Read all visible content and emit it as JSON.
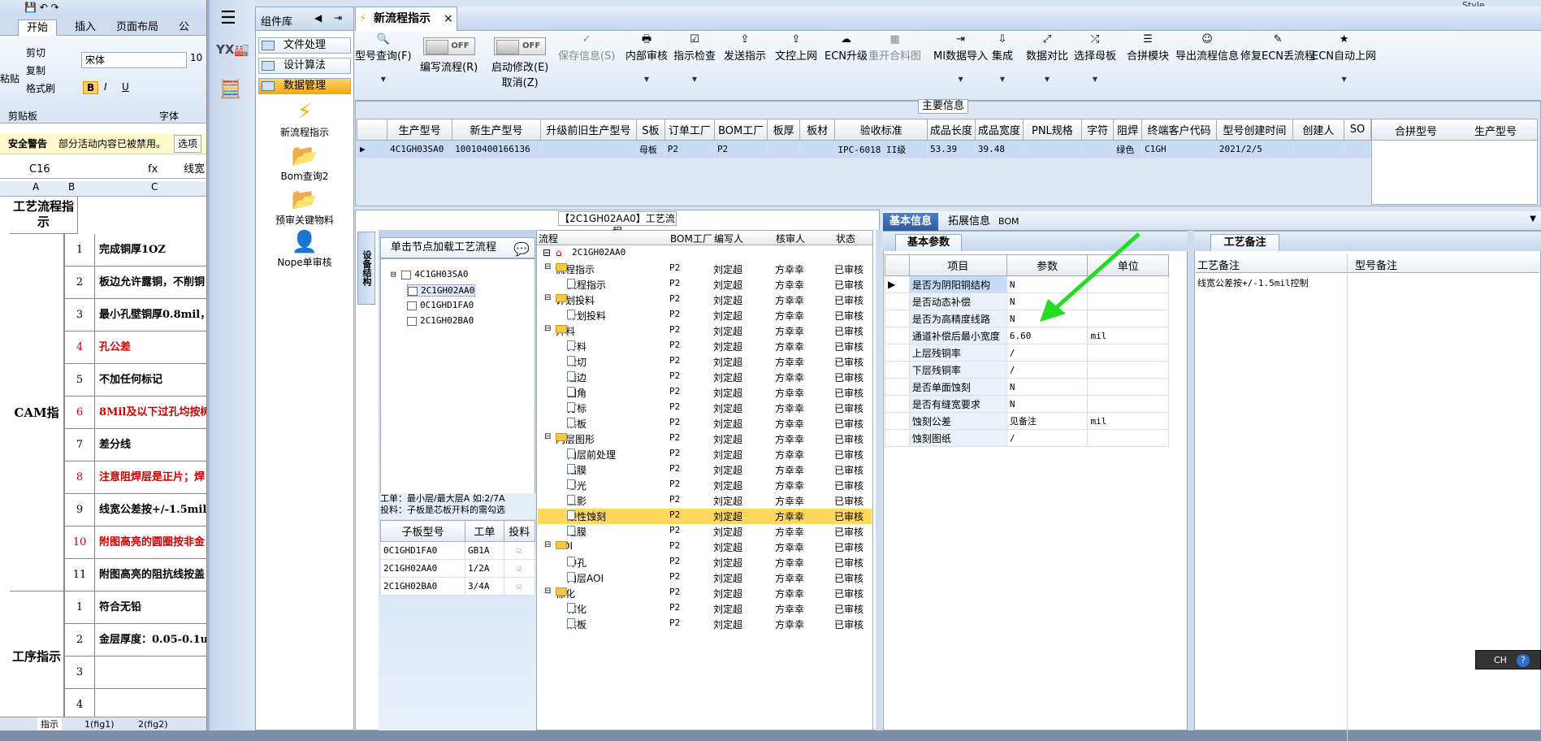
{
  "excel": {
    "tabs": [
      "开始",
      "插入",
      "页面布局",
      "公式"
    ],
    "clipboard": {
      "paste": "粘贴",
      "cut": "剪切",
      "copy": "复制",
      "painter": "格式刷",
      "group": "剪贴板"
    },
    "font": {
      "name": "宋体",
      "size": "10",
      "group": "字体",
      "bold": "B",
      "italic": "I",
      "underline": "U"
    },
    "warning": {
      "title": "安全警告",
      "text": "部分活动内容已被禁用。",
      "button": "选项"
    },
    "namebox": "C16",
    "formula_prefix": "线宽",
    "columns": [
      "A",
      "B",
      "C"
    ],
    "header_label": "工艺流程指示",
    "cam_label": "CAM指示",
    "proc_label": "工序指示",
    "cam_rows": [
      {
        "n": "1",
        "t": "完成铜厚1OZ",
        "red": false
      },
      {
        "n": "2",
        "t": "板边允许露铜，不削铜",
        "red": false
      },
      {
        "n": "3",
        "t": "最小孔壁铜厚0.8mil，",
        "red": false
      },
      {
        "n": "4",
        "t": "孔公差",
        "red": true
      },
      {
        "n": "5",
        "t": "不加任何标记",
        "red": false
      },
      {
        "n": "6",
        "t": "8Mil及以下过孔均按树",
        "red": true
      },
      {
        "n": "7",
        "t": "差分线",
        "red": false
      },
      {
        "n": "8",
        "t": "注意阻焊层是正片；焊",
        "red": true
      },
      {
        "n": "9",
        "t": "线宽公差按+/-1.5mil",
        "red": false
      },
      {
        "n": "10",
        "t": "附图高亮的圆圈按非金",
        "red": true
      },
      {
        "n": "11",
        "t": "附图高亮的阻抗线按盖",
        "red": false
      }
    ],
    "proc_rows": [
      {
        "n": "1",
        "t": "符合无铅",
        "red": false
      },
      {
        "n": "2",
        "t": "金层厚度：0.05-0.1u",
        "red": false
      },
      {
        "n": "3",
        "t": "",
        "red": false
      },
      {
        "n": "4",
        "t": "",
        "red": false
      }
    ],
    "sheets": [
      "指示",
      "1(fig1)",
      "2(fig2)"
    ]
  },
  "app": {
    "style_label": "Style",
    "library_title": "组件库",
    "library_items": [
      "文件处理",
      "设计算法",
      "数据管理"
    ],
    "library_big": [
      "新流程指示",
      "Bom查询2",
      "预审关键物料",
      "Nope单审核"
    ],
    "doc_tab": "新流程指示",
    "toolbar": [
      {
        "label": "型号查询(F)",
        "icon": "🔍",
        "dd": true,
        "dis": false
      },
      {
        "label": "编写流程(R)",
        "toggle": "OFF",
        "dis": false
      },
      {
        "label": "启动修改(E)",
        "label2": "取消(Z)",
        "toggle": "OFF",
        "dis": false
      },
      {
        "label": "保存信息(S)",
        "icon": "✓",
        "dis": true
      },
      {
        "label": "内部审核",
        "icon": "🖶",
        "dd": true,
        "dis": false
      },
      {
        "label": "指示检查",
        "icon": "☑",
        "dd": true,
        "dis": false
      },
      {
        "label": "发送指示",
        "icon": "⇪",
        "dis": false
      },
      {
        "label": "文控上网",
        "icon": "⇪",
        "dis": false
      },
      {
        "label": "ECN升级",
        "icon": "☁",
        "dis": false
      },
      {
        "label": "重开合料图",
        "icon": "▦",
        "dis": true
      },
      {
        "label": "MI数据导入",
        "icon": "⇥",
        "dd": true,
        "dis": false
      },
      {
        "label": "集成",
        "icon": "⇩",
        "dd": true,
        "dis": false
      },
      {
        "label": "数据对比",
        "icon": "⤢",
        "dd": true,
        "dis": false
      },
      {
        "label": "选择母板",
        "icon": "⤮",
        "dd": true,
        "dis": false
      },
      {
        "label": "合拼模块",
        "icon": "☰",
        "dis": false
      },
      {
        "label": "导出流程信息",
        "icon": "☺",
        "dis": false
      },
      {
        "label": "修复ECN丢流程",
        "icon": "✎",
        "dis": false
      },
      {
        "label": "ECN自动上网",
        "icon": "★",
        "dd": true,
        "dis": false
      }
    ],
    "main_info": {
      "title": "主要信息",
      "headers": [
        "生产型号",
        "新生产型号",
        "升级前旧生产型号",
        "S板",
        "订单工厂",
        "BOM工厂",
        "板厚",
        "板材",
        "验收标准",
        "成品长度",
        "成品宽度",
        "PNL规格",
        "字符",
        "阻焊",
        "终端客户代码",
        "型号创建时间",
        "创建人",
        "SO"
      ],
      "row": [
        "4C1GH03SA0",
        "10010400166136",
        "",
        "母板",
        "P2",
        "P2",
        "",
        "",
        "IPC-6018 II级",
        "53.39",
        "39.48",
        "",
        "",
        "绿色",
        "C1GH",
        "2021/2/5",
        "",
        ""
      ],
      "right_headers": [
        "合拼型号",
        "生产型号"
      ]
    },
    "workflow": {
      "title": "【2C1GH02AA0】工艺流程",
      "side_tab": "设备结构",
      "click_hint": "单击节点加载工艺流程",
      "tree": [
        {
          "label": "4C1GH03SA0",
          "level": 0
        },
        {
          "label": "2C1GH02AA0",
          "level": 1,
          "sel": true
        },
        {
          "label": "0C1GHD1FA0",
          "level": 1
        },
        {
          "label": "2C1GH02BA0",
          "level": 1
        }
      ],
      "tip1": "工单：最小层/最大层A 如:2/7A",
      "tip2": "投料：子板是芯板开料的需勾选",
      "child_headers": [
        "子板型号",
        "工单",
        "投料"
      ],
      "child_rows": [
        [
          "0C1GHD1FA0",
          "GB1A"
        ],
        [
          "2C1GH02AA0",
          "1/2A"
        ],
        [
          "2C1GH02BA0",
          "3/4A"
        ]
      ],
      "flow_headers": [
        "流程",
        "BOM工厂",
        "编写人",
        "核审人",
        "状态"
      ],
      "root": "2C1GH02AA0",
      "flow": [
        {
          "name": "流程指示",
          "lvl": 1,
          "folder": true
        },
        {
          "name": "流程指示",
          "lvl": 2
        },
        {
          "name": "计划投料",
          "lvl": 1,
          "folder": true
        },
        {
          "name": "计划投料",
          "lvl": 2
        },
        {
          "name": "开料",
          "lvl": 1,
          "folder": true
        },
        {
          "name": "开料",
          "lvl": 2
        },
        {
          "name": "裁切",
          "lvl": 2
        },
        {
          "name": "磨边",
          "lvl": 2
        },
        {
          "name": "圆角",
          "lvl": 2
        },
        {
          "name": "打标",
          "lvl": 2
        },
        {
          "name": "烘板",
          "lvl": 2
        },
        {
          "name": "内层图形",
          "lvl": 1,
          "folder": true
        },
        {
          "name": "内层前处理",
          "lvl": 2
        },
        {
          "name": "贴膜",
          "lvl": 2
        },
        {
          "name": "曝光",
          "lvl": 2
        },
        {
          "name": "显影",
          "lvl": 2
        },
        {
          "name": "酸性蚀刻",
          "lvl": 2,
          "hl": true
        },
        {
          "name": "退膜",
          "lvl": 2
        },
        {
          "name": "AOI",
          "lvl": 1,
          "folder": true
        },
        {
          "name": "冲孔",
          "lvl": 2
        },
        {
          "name": "内层AOI",
          "lvl": 2
        },
        {
          "name": "棕化",
          "lvl": 1,
          "folder": true
        },
        {
          "name": "棕化",
          "lvl": 2
        },
        {
          "name": "烘板",
          "lvl": 2
        }
      ],
      "bom_factory": "P2",
      "writer": "刘定超",
      "reviewer": "方幸幸",
      "status": "已审核"
    },
    "info_tabs": [
      "基本信息",
      "拓展信息",
      "BOM"
    ],
    "basic": {
      "title": "基本参数",
      "headers": [
        "项目",
        "参数",
        "单位"
      ],
      "rows": [
        [
          "是否为阴阳铜结构",
          "N",
          ""
        ],
        [
          "是否动态补偿",
          "N",
          ""
        ],
        [
          "是否为高精度线路",
          "N",
          ""
        ],
        [
          "通道补偿后最小宽度",
          "6.60",
          "mil"
        ],
        [
          "上层残铜率",
          "/",
          ""
        ],
        [
          "下层残铜率",
          "/",
          ""
        ],
        [
          "是否单面蚀刻",
          "N",
          ""
        ],
        [
          "是否有缝宽要求",
          "N",
          ""
        ],
        [
          "蚀刻公差",
          "见备注",
          "mil"
        ],
        [
          "蚀刻图纸",
          "/",
          ""
        ]
      ]
    },
    "remark": {
      "title": "工艺备注",
      "col1": "工艺备注",
      "col2": "型号备注",
      "text": "线宽公差按+/-1.5mil控制"
    },
    "ime": "CH",
    "arrow_color": "#22dd22"
  }
}
